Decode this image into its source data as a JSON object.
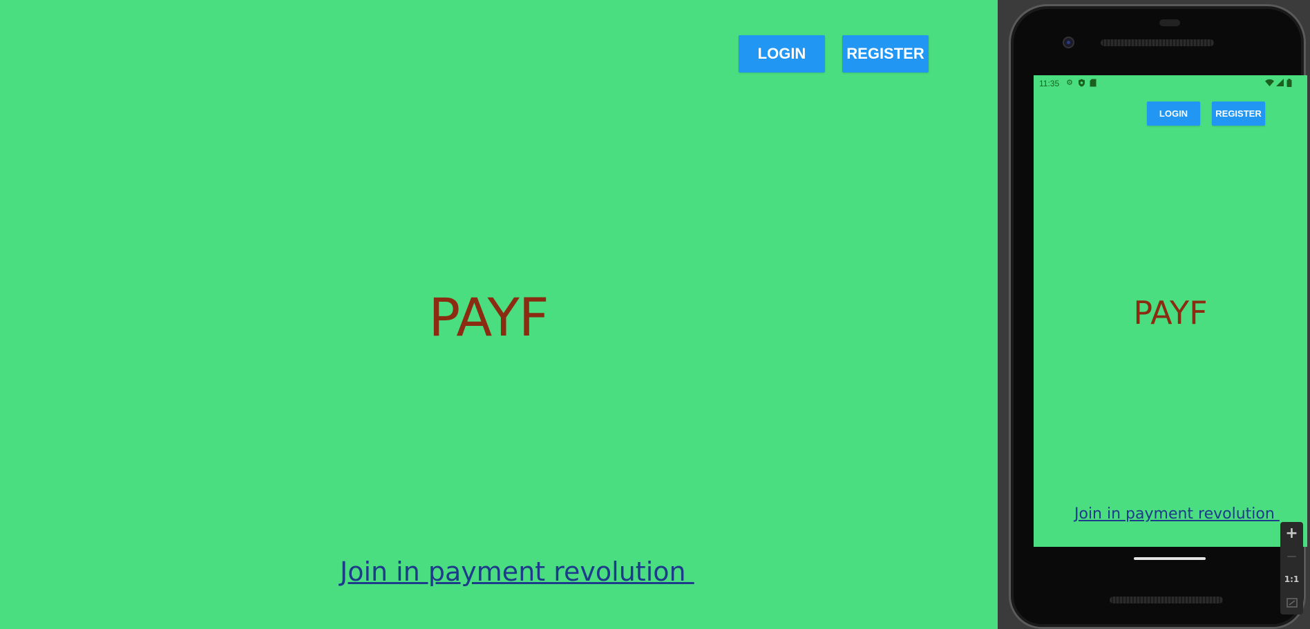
{
  "web": {
    "login_label": "LOGIN",
    "register_label": "REGISTER",
    "title": "PAYF",
    "link_text": "Join in payment revolution "
  },
  "phone": {
    "status_time": "11:35",
    "login_label": "LOGIN",
    "register_label": "REGISTER",
    "title": "PAYF",
    "link_text": "Join in payment revolution "
  },
  "zoom_controls": {
    "zoom_in": "+",
    "zoom_out": "—",
    "actual_size": "1:1"
  },
  "colors": {
    "background": "#4ade80",
    "button": "#2196f3",
    "title": "#8b2c12",
    "link": "#1e3a8a"
  },
  "icons": [
    "settings-icon",
    "shield-icon",
    "sd-card-icon",
    "wifi-icon",
    "signal-icon",
    "battery-icon",
    "zoom-in-icon",
    "zoom-out-icon",
    "fit-screen-icon"
  ]
}
